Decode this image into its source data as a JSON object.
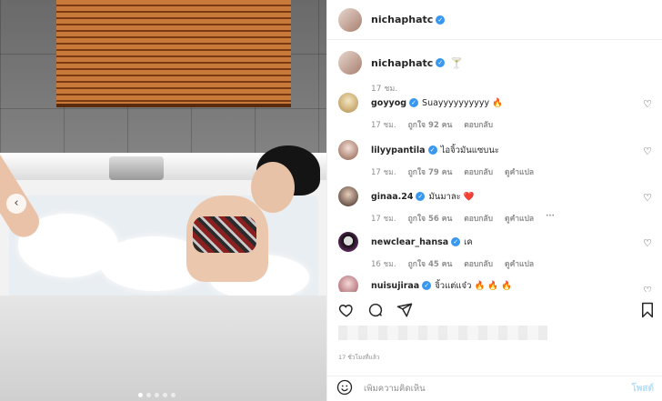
{
  "header": {
    "username": "nichaphatc"
  },
  "caption": {
    "username": "nichaphatc",
    "emoji": "🍸",
    "time": "17 ชม."
  },
  "comments": [
    {
      "username": "goyyog",
      "text": "Suayyyyyyyyyy 🔥",
      "time": "17 ชม.",
      "likes": "ถูกใจ 92 คน",
      "reply": "ตอบกลับ",
      "translate": "",
      "more": ""
    },
    {
      "username": "lilyypantila",
      "text": "ไอจิ้วมันแซบนะ",
      "time": "17 ชม.",
      "likes": "ถูกใจ 79 คน",
      "reply": "ตอบกลับ",
      "translate": "ดูคำแปล",
      "more": ""
    },
    {
      "username": "ginaa.24",
      "text": "มันมาละ ❤️",
      "time": "17 ชม.",
      "likes": "ถูกใจ 56 คน",
      "reply": "ตอบกลับ",
      "translate": "ดูคำแปล",
      "more": "···"
    },
    {
      "username": "newclear_hansa",
      "text": "เค",
      "time": "16 ชม.",
      "likes": "ถูกใจ 45 คน",
      "reply": "ตอบกลับ",
      "translate": "ดูคำแปล",
      "more": ""
    },
    {
      "username": "nuisujiraa",
      "text": "จิ้วแต่แจ๋ว 🔥 🔥 🔥",
      "time": "",
      "likes": "",
      "reply": "",
      "translate": "",
      "more": ""
    }
  ],
  "post": {
    "time": "17 ชั่วโมงที่แล้ว"
  },
  "add_comment": {
    "placeholder": "เพิ่มความคิดเห็น",
    "post_label": "โพสต์"
  },
  "colors": {
    "verified": "#3897f0",
    "post_disabled": "#b2dffc"
  },
  "icons": [
    "heart-icon",
    "comment-icon",
    "share-icon",
    "bookmark-icon",
    "smiley-icon",
    "cocktail-icon",
    "left-arrow-icon"
  ]
}
